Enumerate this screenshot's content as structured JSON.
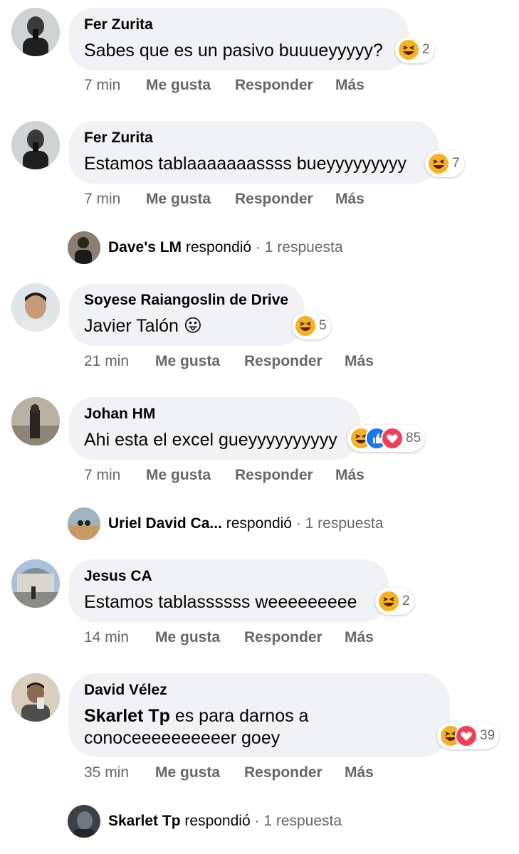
{
  "comments": [
    {
      "author": "Fer Zurita",
      "text": "Sabes que es un pasivo buuueyyyyy?",
      "time": "7 min",
      "like": "Me gusta",
      "reply": "Responder",
      "more": "Más",
      "reaction_count": "2"
    },
    {
      "author": "Fer Zurita",
      "text": "Estamos tablaaaaaaassss bueyyyyyyyyy",
      "time": "7 min",
      "like": "Me gusta",
      "reply": "Responder",
      "more": "Más",
      "reaction_count": "7",
      "replies": {
        "name": "Dave's LM",
        "verb": "respondió",
        "sep": "·",
        "count": "1 respuesta"
      }
    },
    {
      "author": "Soyese Raiangoslin de Drive",
      "text": "Javier Talón 😛",
      "time": "21 min",
      "like": "Me gusta",
      "reply": "Responder",
      "more": "Más",
      "reaction_count": "5"
    },
    {
      "author": "Johan HM",
      "text": "Ahi esta el excel gueyyyyyyyyyy",
      "time": "7 min",
      "like": "Me gusta",
      "reply": "Responder",
      "more": "Más",
      "reaction_count": "85",
      "replies": {
        "name": "Uriel David Ca...",
        "verb": "respondió",
        "sep": "·",
        "count": "1 respuesta"
      }
    },
    {
      "author": "Jesus CA",
      "text": "Estamos tablassssss weeeeeeeee",
      "time": "14 min",
      "like": "Me gusta",
      "reply": "Responder",
      "more": "Más",
      "reaction_count": "2"
    },
    {
      "author": "David Vélez",
      "mention": "Skarlet Tp",
      "text_line1": " es para darnos a",
      "text_line2": "conoceeeeeeeeeer goey",
      "time": "35 min",
      "like": "Me gusta",
      "reply": "Responder",
      "more": "Más",
      "reaction_count": "39",
      "replies": {
        "name": "Skarlet Tp",
        "verb": "respondió",
        "sep": "·",
        "count": "1 respuesta"
      }
    }
  ],
  "colors": {
    "bubble": "#f0f2f5",
    "meta": "#65676b",
    "haha": "#f7b125",
    "like": "#1877f2",
    "love": "#f33e58"
  },
  "icons": {
    "haha": "haha-reaction-icon",
    "like": "like-reaction-icon",
    "love": "love-reaction-icon"
  }
}
